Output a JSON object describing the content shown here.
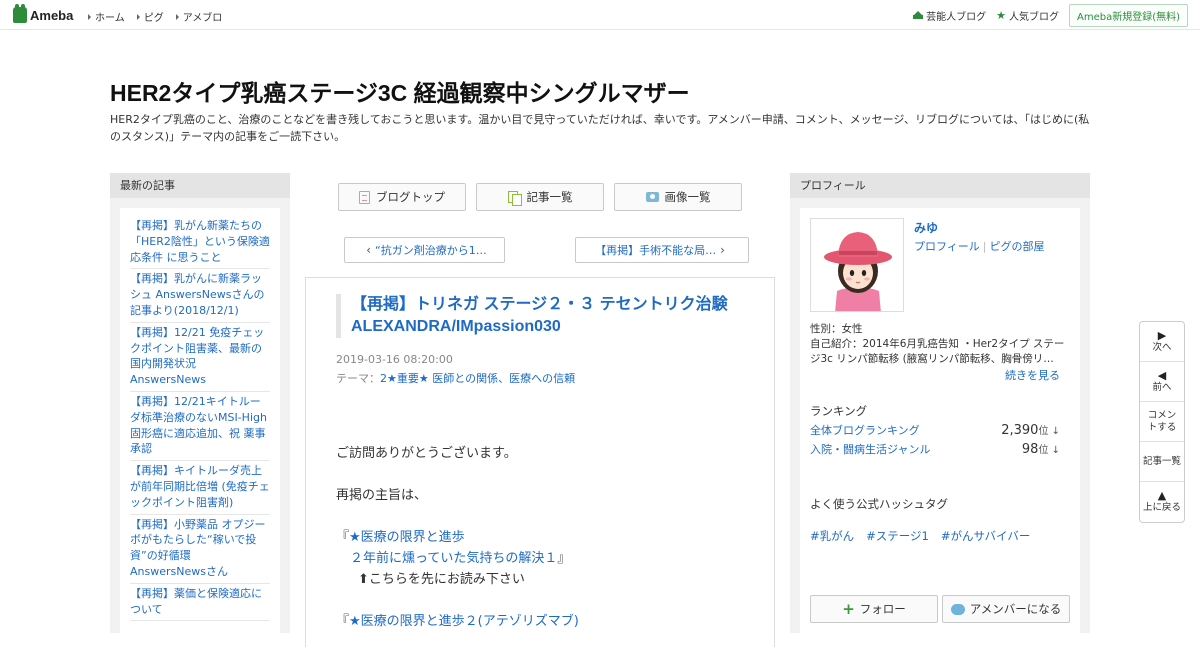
{
  "topbar": {
    "logo_text": "Ameba",
    "nav": [
      "ホーム",
      "ピグ",
      "アメブロ"
    ],
    "right_links": [
      "芸能人ブログ",
      "人気ブログ"
    ],
    "signup_label": "Ameba新規登録(無料)"
  },
  "header": {
    "title": "HER2タイプ乳癌ステージ3C 経過観察中シングルマザー",
    "description": "HER2タイプ乳癌のこと、治療のことなどを書き残しておこうと思います。温かい目で見守っていただければ、幸いです。アメンバー申請、コメント、メッセージ、リブログについては、「はじめに(私のスタンス)」テーマ内の記事をご一読下さい。"
  },
  "left_sidebar": {
    "heading": "最新の記事",
    "items": [
      "【再掲】乳がん新薬たちの「HER2陰性」という保険適応条件 に思うこと",
      "【再掲】乳がんに新薬ラッシュ AnswersNewsさんの記事より(2018/12/1)",
      "【再掲】12/21 免疫チェックポイント阻害薬、最新の国内開発状況 AnswersNews",
      "【再掲】12/21キイトルーダ标準治療のないMSI-High固形癌に適応追加、祝 薬事承認",
      "【再掲】キイトルーダ売上が前年同期比倍増 (免疫チェックポイント阻害剤)",
      "【再掲】小野薬品 オプジーボがもたらした“稼いで投資”の好循環 AnswersNewsさん",
      "【再掲】薬価と保険適応について"
    ]
  },
  "center": {
    "buttons": [
      "ブログトップ",
      "記事一覧",
      "画像一覧"
    ],
    "prev_label": "“抗ガン剤治療から1…",
    "next_label": "【再掲】手術不能な局…"
  },
  "article": {
    "title": "【再掲】トリネガ ステージ２・３ テセントリク治験ALEXANDRA/IMpassion030",
    "date": "2019-03-16 08:20:00",
    "theme_label": "テーマ：",
    "theme": "2★重要★ 医師との関係、医療への信頼",
    "body": {
      "line1": "ご訪問ありがとうございます。",
      "line2": "再掲の主旨は、",
      "quote1_open": "『",
      "quote1_a": "★医療の限界と進歩",
      "quote1_b": "２年前に燻っていた気持ちの解決１",
      "quote1_close": "』",
      "note": "⬆こちらを先にお読み下さい",
      "quote2_open": "『",
      "quote2_a": "★医療の限界と進歩２(アテゾリズマブ)"
    }
  },
  "right_sidebar": {
    "heading": "プロフィール",
    "name": "みゆ",
    "profile_link": "プロフィール",
    "pig_link": "ピグの部屋",
    "gender": "性別：女性",
    "intro": "自己紹介：2014年6月乳癌告知 ・Her2タイプ ステージ3c リンパ節転移 (腋窩リンパ節転移、胸骨傍リ…",
    "more": "続きを見る",
    "ranking_heading": "ランキング",
    "rankings": [
      {
        "label": "全体ブログランキング",
        "value": "2,390",
        "unit": "位 ↓"
      },
      {
        "label": "入院・闘病生活ジャンル",
        "value": "98",
        "unit": "位 ↓"
      }
    ],
    "hashtag_heading": "よく使う公式ハッシュタグ",
    "hashtags": [
      "#乳がん",
      "#ステージ1",
      "#がんサバイバー"
    ],
    "follow_label": "フォロー",
    "member_label": "アメンバーになる"
  },
  "floatnav": {
    "next": "次へ",
    "prev": "前へ",
    "comment": "コメントする",
    "list": "記事一覧",
    "top": "上に戻る"
  },
  "colors": {
    "link": "#1f6bc4",
    "brand_green": "#2d8c3c",
    "sidebar_bg": "#f2f2f2"
  }
}
